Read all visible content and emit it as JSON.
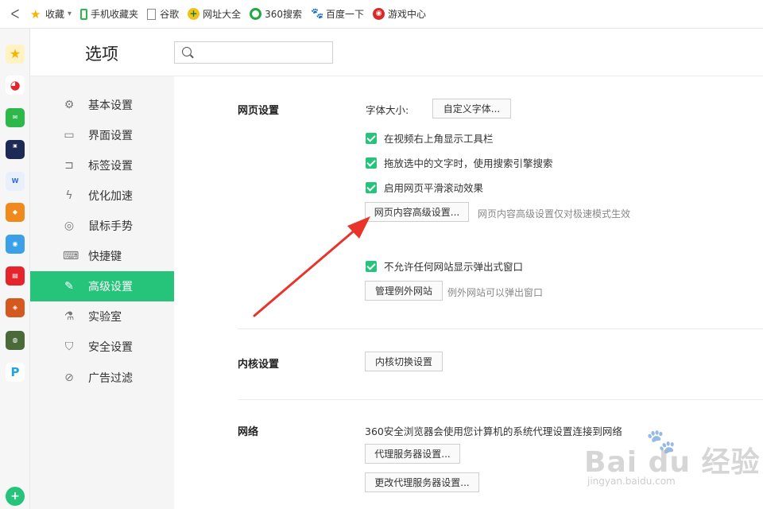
{
  "bookmarks": {
    "back": "ᐸ",
    "items": [
      {
        "label": "收藏",
        "icon": "star-icon"
      },
      {
        "label": "手机收藏夹",
        "icon": "phone-icon"
      },
      {
        "label": "谷歌",
        "icon": "document-icon"
      },
      {
        "label": "网址大全",
        "icon": "plus-circle-icon"
      },
      {
        "label": "360搜索",
        "icon": "circle-360-icon"
      },
      {
        "label": "百度一下",
        "icon": "paw-icon"
      },
      {
        "label": "游戏中心",
        "icon": "game-icon"
      }
    ]
  },
  "header": {
    "title": "选项",
    "search_placeholder": ""
  },
  "nav": {
    "items": [
      {
        "label": "基本设置",
        "icon": "⚙"
      },
      {
        "label": "界面设置",
        "icon": "▭"
      },
      {
        "label": "标签设置",
        "icon": "⊐"
      },
      {
        "label": "优化加速",
        "icon": "ϟ"
      },
      {
        "label": "鼠标手势",
        "icon": "◎"
      },
      {
        "label": "快捷键",
        "icon": "⌨"
      },
      {
        "label": "高级设置",
        "icon": "✎"
      },
      {
        "label": "实验室",
        "icon": "⚗"
      },
      {
        "label": "安全设置",
        "icon": "⛉"
      },
      {
        "label": "广告过滤",
        "icon": "⊘"
      }
    ],
    "active_index": 6
  },
  "webpage": {
    "title": "网页设置",
    "font_size_label": "字体大小:",
    "custom_font_button": "自定义字体...",
    "check_toolbar": "在视频右上角显示工具栏",
    "check_drag_search": "拖放选中的文字时，使用搜索引擎搜索",
    "check_smooth_scroll": "启用网页平滑滚动效果",
    "advanced_button": "网页内容高级设置...",
    "advanced_hint": "网页内容高级设置仅对极速模式生效",
    "check_popup": "不允许任何网站显示弹出式窗口",
    "exceptions_button": "管理例外网站",
    "exceptions_hint": "例外网站可以弹出窗口"
  },
  "kernel": {
    "title": "内核设置",
    "switch_button": "内核切换设置"
  },
  "network": {
    "title": "网络",
    "desc": "360安全浏览器会使用您计算机的系统代理设置连接到网络",
    "proxy_button": "代理服务器设置...",
    "change_proxy_button": "更改代理服务器设置..."
  },
  "watermark": {
    "main": "Bai du 经验",
    "sub": "jingyan.baidu.com"
  },
  "colors": {
    "accent": "#25c47a",
    "arrow": "#e8342b"
  }
}
